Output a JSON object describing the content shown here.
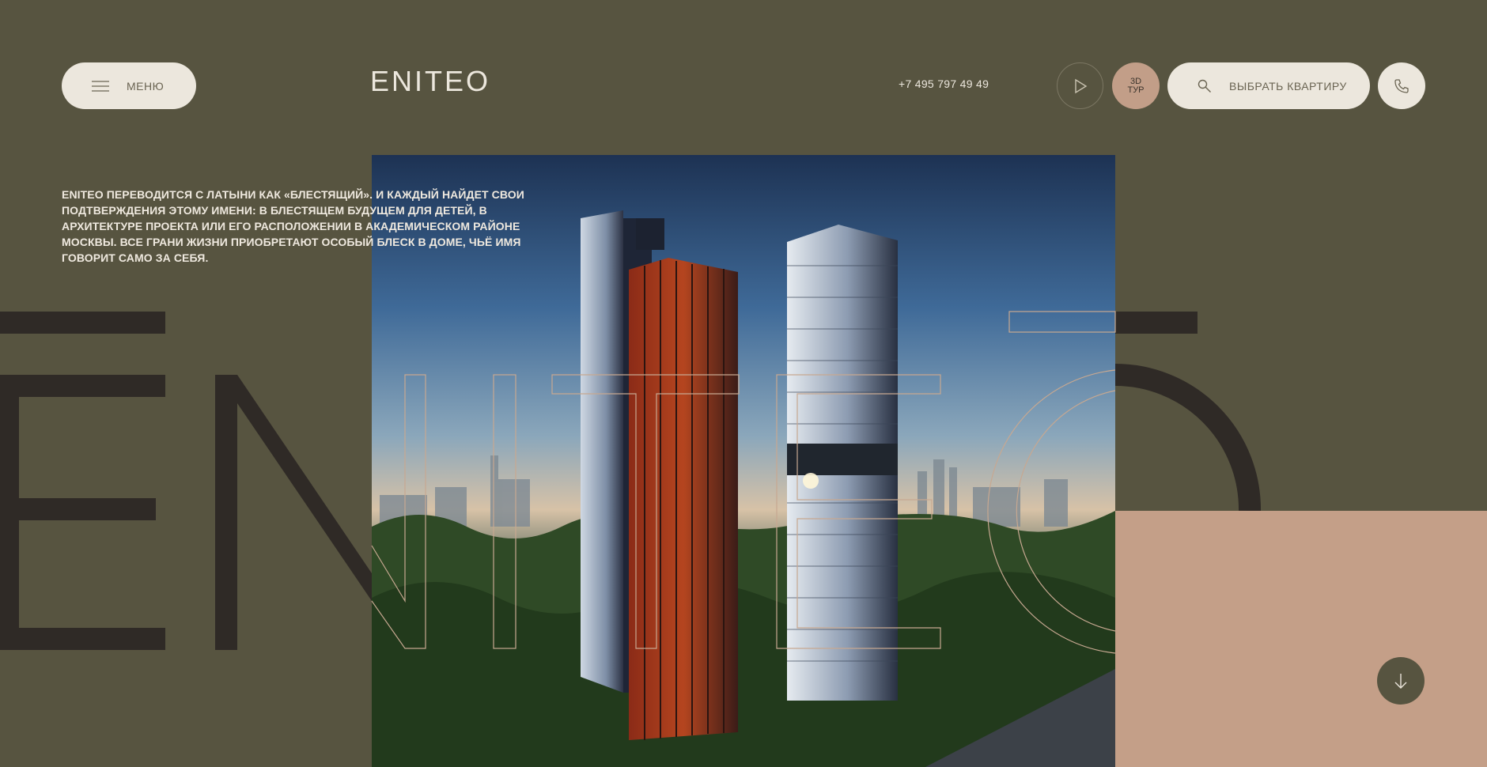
{
  "header": {
    "menu_label": "МЕНЮ",
    "menu_icon": "hamburger-icon",
    "logo_text": "ENITEO",
    "phone": "+7 495 797 49 49",
    "video_icon": "play-icon",
    "tour_line1": "3D",
    "tour_line2": "ТУР",
    "choose_label": "ВЫБРАТЬ КВАРТИРУ",
    "choose_icon": "search-icon",
    "call_icon": "phone-icon"
  },
  "intro": {
    "text": "ENITEO ПЕРЕВОДИТСЯ С ЛАТЫНИ КАК «БЛЕСТЯЩИЙ». И КАЖДЫЙ НАЙДЕТ СВОИ ПОДТВЕРЖДЕНИЯ ЭТОМУ ИМЕНИ: В БЛЕСТЯЩЕМ БУДУЩЕМ ДЛЯ ДЕТЕЙ, В АРХИТЕКТУРЕ ПРОЕКТА ИЛИ ЕГО РАСПОЛОЖЕНИИ В АКАДЕМИЧЕСКОМ РАЙОНЕ МОСКВЫ. ВСЕ ГРАНИ ЖИЗНИ ПРИОБРЕТАЮТ ОСОБЫЙ БЛЕСК В ДОМЕ, ЧЬЁ ИМЯ ГОВОРИТ САМО ЗА СЕБЯ."
  },
  "hero": {
    "image": "twin-towers-render"
  },
  "scroll": {
    "icon": "arrow-down-icon"
  },
  "colors": {
    "background": "#575440",
    "accent": "#c49f88",
    "light": "#ece7dd",
    "dark_letters": "#2f2a26"
  }
}
